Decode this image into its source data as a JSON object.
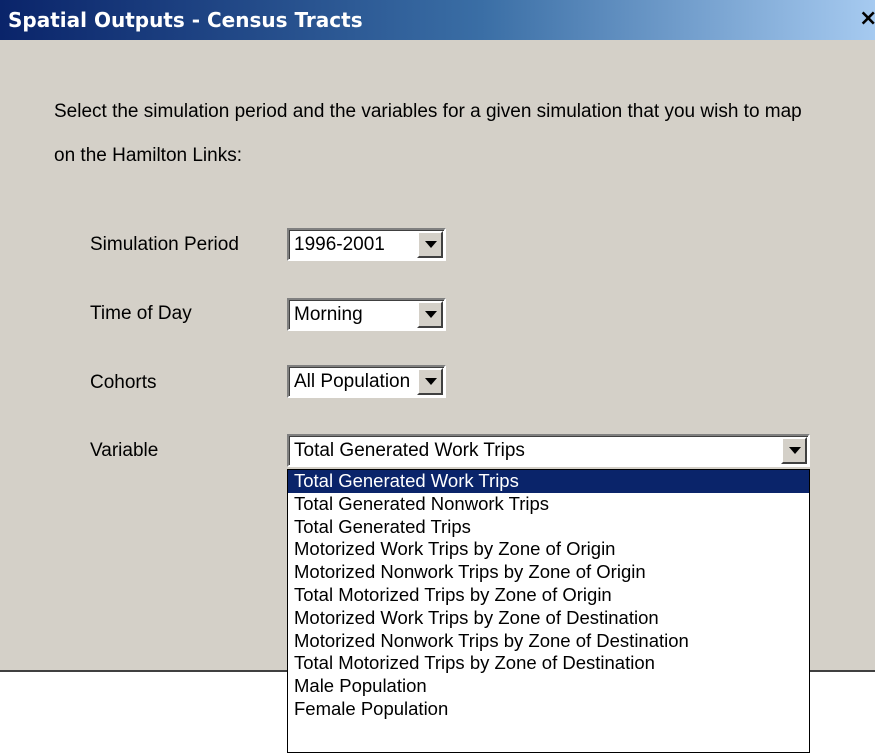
{
  "window": {
    "title": "Spatial Outputs - Census Tracts",
    "close_glyph": "×"
  },
  "instructions": "Select the simulation period and the variables for a given simulation that you wish to map on the Hamilton Links:",
  "fields": {
    "simulation_period": {
      "label": "Simulation Period",
      "value": "1996-2001"
    },
    "time_of_day": {
      "label": "Time of Day",
      "value": "Morning"
    },
    "cohorts": {
      "label": "Cohorts",
      "value": "All Population"
    },
    "variable": {
      "label": "Variable",
      "value": "Total Generated Work Trips"
    }
  },
  "dropdown": {
    "selected_index": 0,
    "options": [
      "Total Generated Work Trips",
      "Total Generated Nonwork Trips",
      "Total Generated Trips",
      "Motorized Work Trips by Zone of Origin",
      "Motorized Nonwork Trips by Zone of Origin",
      "Total Motorized Trips by Zone of Origin",
      "Motorized Work Trips by Zone of Destination",
      "Motorized Nonwork Trips by Zone of Destination",
      "Total Motorized Trips by Zone of Destination",
      "Male Population",
      "Female Population"
    ]
  },
  "icons": {
    "close": "close-icon",
    "dropdown_arrow": "chevron-down-icon"
  },
  "colors": {
    "titlebar_start": "#0a246a",
    "titlebar_end": "#a6caf0",
    "dialog_bg": "#d4d0c8",
    "selection_bg": "#0a246a"
  }
}
